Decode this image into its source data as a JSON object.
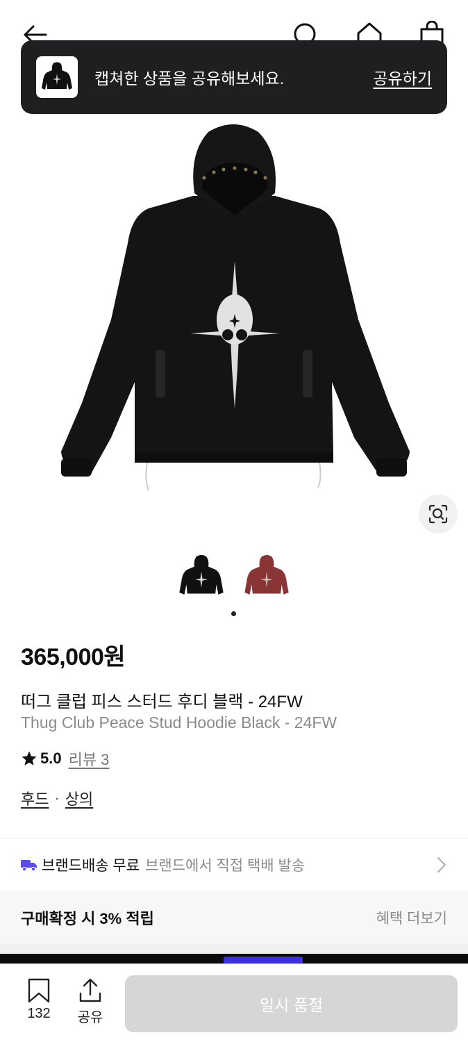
{
  "toast": {
    "message": "캡쳐한 상품을 공유해보세요.",
    "action_label": "공유하기"
  },
  "product": {
    "price": "365,000원",
    "name_ko": "떠그 클럽 피스 스터드 후디 블랙 - 24FW",
    "name_en": "Thug Club Peace Stud Hoodie Black - 24FW",
    "rating": "5.0",
    "reviews_label": "리뷰 3",
    "categories": [
      "후드",
      "상의"
    ],
    "category_separator": "·",
    "variant_colors": [
      "#111111",
      "#8a3535"
    ],
    "selected_variant": 0
  },
  "shipping": {
    "label": "브랜드배송 무료",
    "desc": "브랜드에서 직접 택배 발송",
    "icon": "truck-icon",
    "icon_color": "#5b4cf0"
  },
  "benefit": {
    "title": "구매확정 시 3% 적립",
    "more_label": "혜택 더보기"
  },
  "bottom_bar": {
    "likes_count": "132",
    "share_label": "공유",
    "buy_button_label": "일시 품절"
  },
  "colors": {
    "toast_bg": "#1f1f21",
    "disabled_button": "#d6d6d6",
    "accent": "#5b4cf0"
  }
}
